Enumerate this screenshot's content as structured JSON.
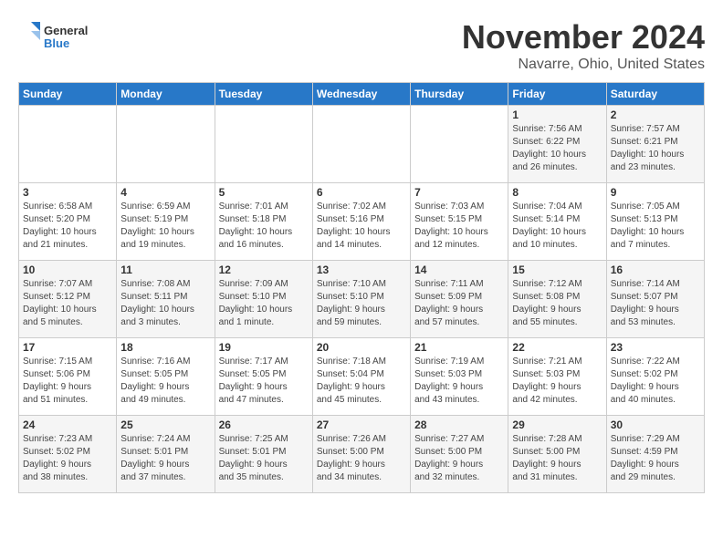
{
  "logo": {
    "text_general": "General",
    "text_blue": "Blue"
  },
  "header": {
    "month": "November 2024",
    "location": "Navarre, Ohio, United States"
  },
  "weekdays": [
    "Sunday",
    "Monday",
    "Tuesday",
    "Wednesday",
    "Thursday",
    "Friday",
    "Saturday"
  ],
  "weeks": [
    [
      {
        "day": "",
        "info": ""
      },
      {
        "day": "",
        "info": ""
      },
      {
        "day": "",
        "info": ""
      },
      {
        "day": "",
        "info": ""
      },
      {
        "day": "",
        "info": ""
      },
      {
        "day": "1",
        "info": "Sunrise: 7:56 AM\nSunset: 6:22 PM\nDaylight: 10 hours\nand 26 minutes."
      },
      {
        "day": "2",
        "info": "Sunrise: 7:57 AM\nSunset: 6:21 PM\nDaylight: 10 hours\nand 23 minutes."
      }
    ],
    [
      {
        "day": "3",
        "info": "Sunrise: 6:58 AM\nSunset: 5:20 PM\nDaylight: 10 hours\nand 21 minutes."
      },
      {
        "day": "4",
        "info": "Sunrise: 6:59 AM\nSunset: 5:19 PM\nDaylight: 10 hours\nand 19 minutes."
      },
      {
        "day": "5",
        "info": "Sunrise: 7:01 AM\nSunset: 5:18 PM\nDaylight: 10 hours\nand 16 minutes."
      },
      {
        "day": "6",
        "info": "Sunrise: 7:02 AM\nSunset: 5:16 PM\nDaylight: 10 hours\nand 14 minutes."
      },
      {
        "day": "7",
        "info": "Sunrise: 7:03 AM\nSunset: 5:15 PM\nDaylight: 10 hours\nand 12 minutes."
      },
      {
        "day": "8",
        "info": "Sunrise: 7:04 AM\nSunset: 5:14 PM\nDaylight: 10 hours\nand 10 minutes."
      },
      {
        "day": "9",
        "info": "Sunrise: 7:05 AM\nSunset: 5:13 PM\nDaylight: 10 hours\nand 7 minutes."
      }
    ],
    [
      {
        "day": "10",
        "info": "Sunrise: 7:07 AM\nSunset: 5:12 PM\nDaylight: 10 hours\nand 5 minutes."
      },
      {
        "day": "11",
        "info": "Sunrise: 7:08 AM\nSunset: 5:11 PM\nDaylight: 10 hours\nand 3 minutes."
      },
      {
        "day": "12",
        "info": "Sunrise: 7:09 AM\nSunset: 5:10 PM\nDaylight: 10 hours\nand 1 minute."
      },
      {
        "day": "13",
        "info": "Sunrise: 7:10 AM\nSunset: 5:10 PM\nDaylight: 9 hours\nand 59 minutes."
      },
      {
        "day": "14",
        "info": "Sunrise: 7:11 AM\nSunset: 5:09 PM\nDaylight: 9 hours\nand 57 minutes."
      },
      {
        "day": "15",
        "info": "Sunrise: 7:12 AM\nSunset: 5:08 PM\nDaylight: 9 hours\nand 55 minutes."
      },
      {
        "day": "16",
        "info": "Sunrise: 7:14 AM\nSunset: 5:07 PM\nDaylight: 9 hours\nand 53 minutes."
      }
    ],
    [
      {
        "day": "17",
        "info": "Sunrise: 7:15 AM\nSunset: 5:06 PM\nDaylight: 9 hours\nand 51 minutes."
      },
      {
        "day": "18",
        "info": "Sunrise: 7:16 AM\nSunset: 5:05 PM\nDaylight: 9 hours\nand 49 minutes."
      },
      {
        "day": "19",
        "info": "Sunrise: 7:17 AM\nSunset: 5:05 PM\nDaylight: 9 hours\nand 47 minutes."
      },
      {
        "day": "20",
        "info": "Sunrise: 7:18 AM\nSunset: 5:04 PM\nDaylight: 9 hours\nand 45 minutes."
      },
      {
        "day": "21",
        "info": "Sunrise: 7:19 AM\nSunset: 5:03 PM\nDaylight: 9 hours\nand 43 minutes."
      },
      {
        "day": "22",
        "info": "Sunrise: 7:21 AM\nSunset: 5:03 PM\nDaylight: 9 hours\nand 42 minutes."
      },
      {
        "day": "23",
        "info": "Sunrise: 7:22 AM\nSunset: 5:02 PM\nDaylight: 9 hours\nand 40 minutes."
      }
    ],
    [
      {
        "day": "24",
        "info": "Sunrise: 7:23 AM\nSunset: 5:02 PM\nDaylight: 9 hours\nand 38 minutes."
      },
      {
        "day": "25",
        "info": "Sunrise: 7:24 AM\nSunset: 5:01 PM\nDaylight: 9 hours\nand 37 minutes."
      },
      {
        "day": "26",
        "info": "Sunrise: 7:25 AM\nSunset: 5:01 PM\nDaylight: 9 hours\nand 35 minutes."
      },
      {
        "day": "27",
        "info": "Sunrise: 7:26 AM\nSunset: 5:00 PM\nDaylight: 9 hours\nand 34 minutes."
      },
      {
        "day": "28",
        "info": "Sunrise: 7:27 AM\nSunset: 5:00 PM\nDaylight: 9 hours\nand 32 minutes."
      },
      {
        "day": "29",
        "info": "Sunrise: 7:28 AM\nSunset: 5:00 PM\nDaylight: 9 hours\nand 31 minutes."
      },
      {
        "day": "30",
        "info": "Sunrise: 7:29 AM\nSunset: 4:59 PM\nDaylight: 9 hours\nand 29 minutes."
      }
    ]
  ]
}
